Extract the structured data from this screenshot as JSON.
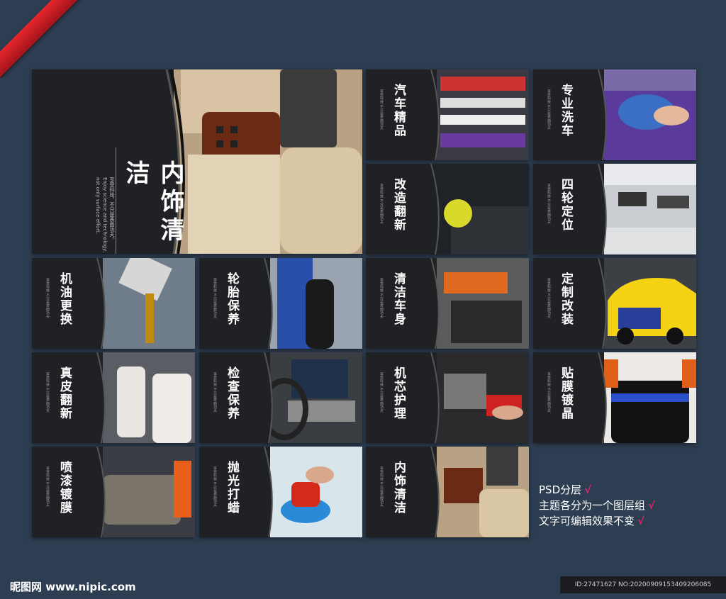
{
  "cards": {
    "main": {
      "title": "内饰清洁",
      "sub1": "享受科技，不只是表面功夫。",
      "sub2": "Enjoy science and technology, not only surface effort."
    },
    "c1": {
      "title": "汽车精品"
    },
    "c2": {
      "title": "专业洗车"
    },
    "c3": {
      "title": "改造翻新"
    },
    "c4": {
      "title": "四轮定位"
    },
    "c5": {
      "title": "机油更换"
    },
    "c6": {
      "title": "轮胎保养"
    },
    "c7": {
      "title": "清洁车身"
    },
    "c8": {
      "title": "定制改装"
    },
    "c9": {
      "title": "真皮翻新"
    },
    "c10": {
      "title": "检查保养"
    },
    "c11": {
      "title": "机芯护理"
    },
    "c12": {
      "title": "贴膜镀晶"
    },
    "c13": {
      "title": "喷漆镀膜"
    },
    "c14": {
      "title": "抛光打蜡"
    },
    "c15": {
      "title": "内饰清洁"
    }
  },
  "notes": {
    "line1": "PSD分层",
    "line2": "主题各分为一个图层组",
    "line3": "文字可编辑效果不变",
    "check": "√"
  },
  "footer": {
    "logo": "昵图网 www.nipic.com",
    "id": "ID:27471627 NO:20200909153409206085"
  }
}
